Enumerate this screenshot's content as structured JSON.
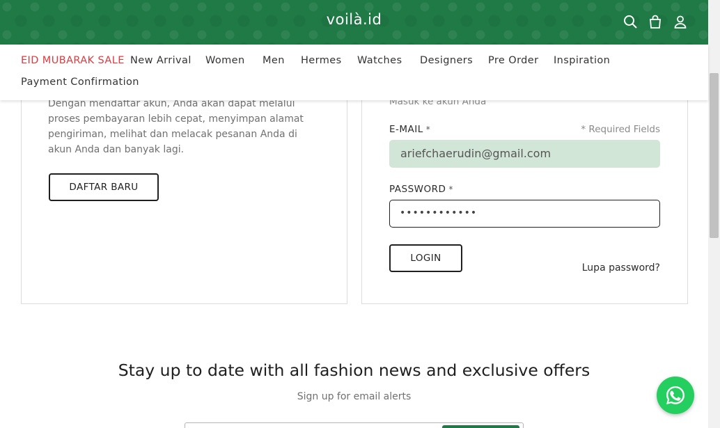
{
  "header": {
    "logo": "voilà.id",
    "icons": [
      "search-icon",
      "cart-icon",
      "user-icon"
    ],
    "background_color": "#1f7a45"
  },
  "nav": {
    "items": [
      {
        "label": "EID MUBARAK SALE",
        "highlight": true
      },
      {
        "label": "New Arrival"
      },
      {
        "label": "Women"
      },
      {
        "label": "Men"
      },
      {
        "label": "Hermes"
      },
      {
        "label": "Watches"
      },
      {
        "label": "Designers"
      },
      {
        "label": "Pre Order"
      },
      {
        "label": "Inspiration"
      },
      {
        "label": "Payment Confirmation"
      }
    ],
    "sale_color": "#e0393e"
  },
  "register": {
    "description": "Dengan mendaftar akun, Anda akan dapat melalui proses pembayaran lebih cepat, menyimpan alamat pengiriman, melihat dan melacak pesanan Anda di akun Anda dan banyak lagi.",
    "button_label": "DAFTAR BARU"
  },
  "login": {
    "subtitle": "Masuk ke akun Anda",
    "email_label": "E-MAIL",
    "required_mark": "*",
    "required_fields_note": "* Required Fields",
    "email_value": "ariefchaerudin@gmail.com",
    "password_label": "PASSWORD",
    "password_value": "••••••••••••",
    "login_button": "LOGIN",
    "forgot_link": "Lupa password?"
  },
  "newsletter": {
    "title": "Stay up to date with all fashion news and exclusive offers",
    "subtitle": "Sign up for email alerts"
  },
  "whatsapp": {
    "icon": "whatsapp-icon",
    "color": "#25cf5f"
  }
}
